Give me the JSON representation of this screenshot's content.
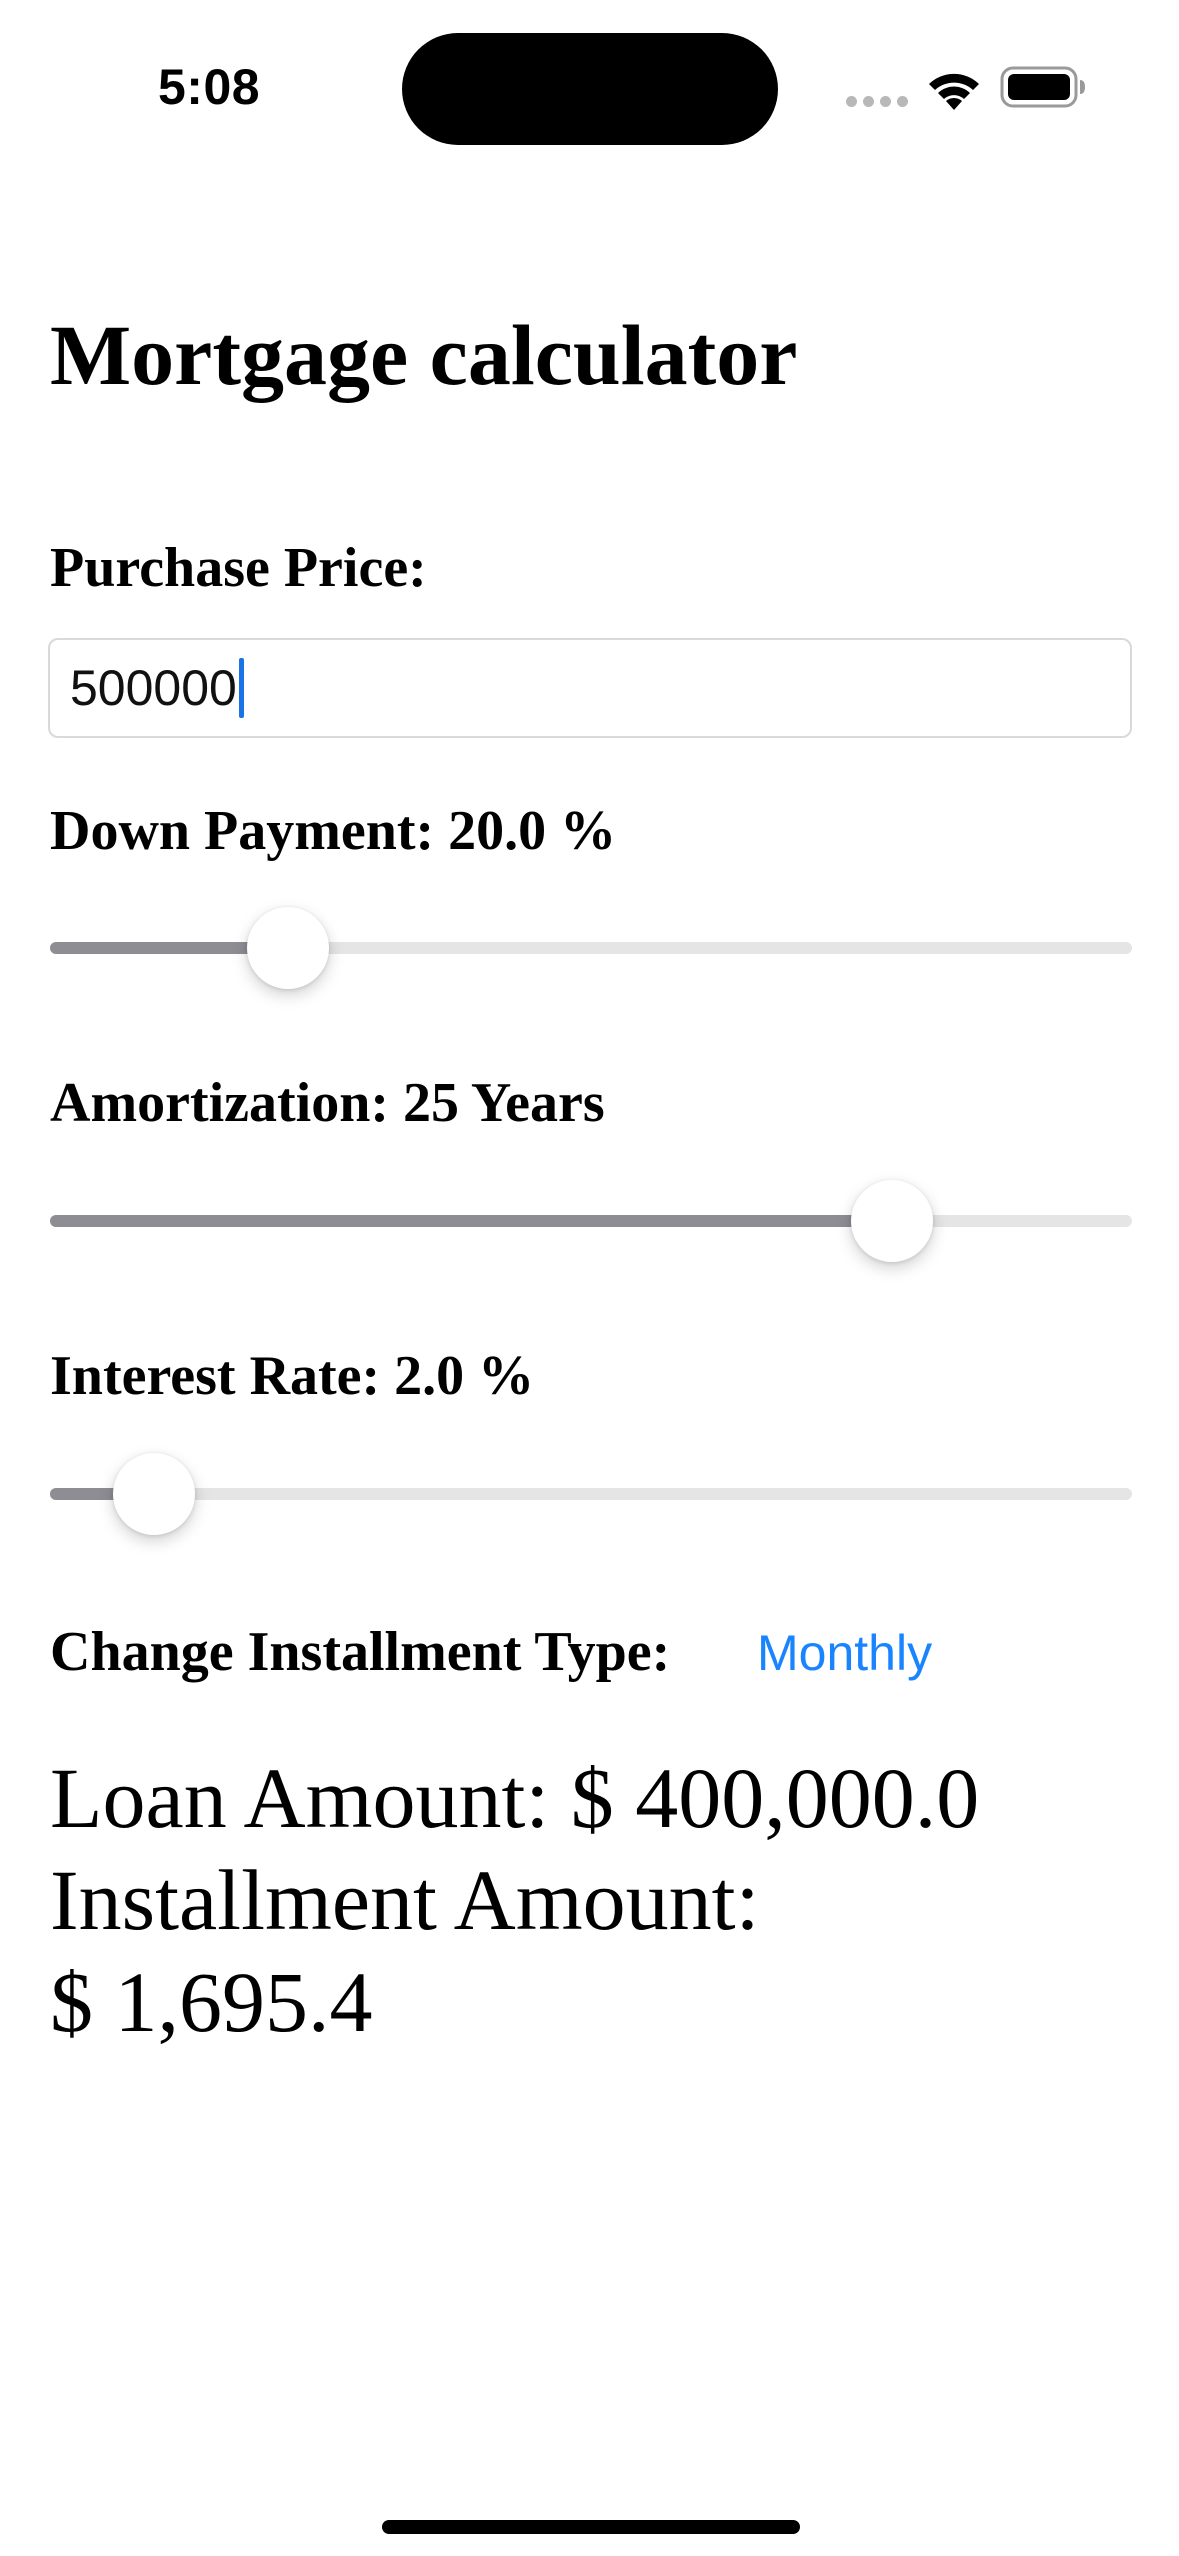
{
  "status_bar": {
    "time": "5:08",
    "icons": [
      "signal-dots-icon",
      "wifi-icon",
      "battery-icon"
    ]
  },
  "page": {
    "title": "Mortgage calculator"
  },
  "purchase_price": {
    "label": "Purchase Price:",
    "value": "500000"
  },
  "down_payment": {
    "label": "Down Payment: 20.0 %",
    "slider_fraction": 0.22
  },
  "amortization": {
    "label": "Amortization: 25 Years",
    "slider_fraction": 0.778
  },
  "interest_rate": {
    "label": "Interest Rate: 2.0 %",
    "slider_fraction": 0.096
  },
  "installment": {
    "label": "Change Installment Type:",
    "type_button": "Monthly"
  },
  "results": {
    "loan_amount": "Loan Amount: $ 400,000.0",
    "installment_label": "Installment Amount:",
    "installment_value": "$ 1,695.4"
  },
  "colors": {
    "accent": "#1a84ff",
    "caret": "#1a73e8",
    "slider_fill": "#8d8d93",
    "slider_track": "#e5e5e5"
  }
}
